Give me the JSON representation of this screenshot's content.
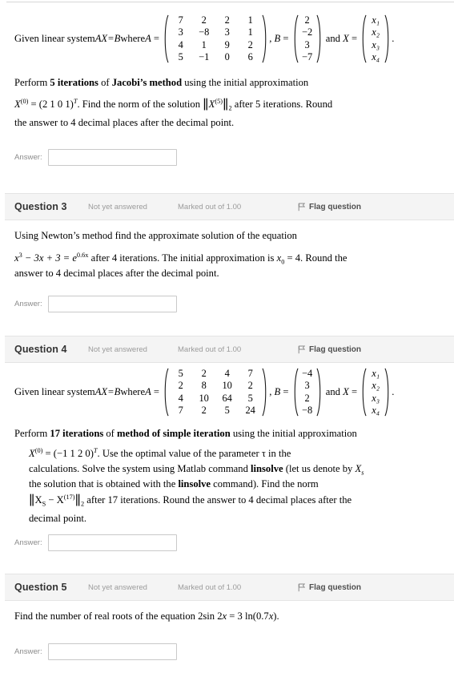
{
  "page": {
    "answer_label": "Answer:",
    "answer_placeholder": "",
    "answer_value": "",
    "flag_label": "Flag question",
    "state_label": "Not yet answered",
    "mark_label": "Marked out of 1.00"
  },
  "q2": {
    "intro": "Given linear system ",
    "system_name": "AX=B",
    "where": " where ",
    "A_label": "A",
    "A": [
      [
        "7",
        "2",
        "2",
        "1"
      ],
      [
        "3",
        "−8",
        "3",
        "1"
      ],
      [
        "4",
        "1",
        "9",
        "2"
      ],
      [
        "5",
        "−1",
        "0",
        "6"
      ]
    ],
    "B_label": "B",
    "B": [
      "2",
      "−2",
      "3",
      "−7"
    ],
    "and": "and",
    "X_label": "X",
    "X": [
      "x₁",
      "x₂",
      "x₃",
      "x₄"
    ],
    "line2_a": "Perform ",
    "line2_b": "5 iterations",
    "line2_c": " of ",
    "line2_d": "Jacobi’s method",
    "line2_e": " using the initial approximation",
    "line3_x0": "X",
    "line3_sup": "(0)",
    "line3_eq": " = (2   1   0   1)",
    "line3_T": "T",
    "line3_mid": ". Find the norm of the solution ",
    "line3_norm": "X",
    "line3_norm_sup": "(5)",
    "line3_norm_sub": "2",
    "line3_tail": " after 5 iterations. Round",
    "line4": "the answer to 4 decimal places after the decimal point."
  },
  "q3": {
    "number": "Question 3",
    "line1": "Using Newton’s method find the approximate solution of the equation",
    "eq_x": "x",
    "eq_x_sup": "3",
    "eq_mid": " − 3x + 3 = ",
    "eq_e": "e",
    "eq_e_sup": "0.6x",
    "eq_tail": " after 4 iterations. The initial approximation is ",
    "eq_x0": "x",
    "eq_x0_sub": "0",
    "eq_val": " = 4. Round the",
    "line3": "answer to 4 decimal places after the decimal point."
  },
  "q4": {
    "number": "Question 4",
    "intro": "Given linear system ",
    "system_name": "AX=B",
    "where": " where ",
    "A_label": "A",
    "A": [
      [
        "5",
        "2",
        "4",
        "7"
      ],
      [
        "2",
        "8",
        "10",
        "2"
      ],
      [
        "4",
        "10",
        "64",
        "5"
      ],
      [
        "7",
        "2",
        "5",
        "24"
      ]
    ],
    "B_label": "B",
    "B": [
      "−4",
      "3",
      "2",
      "−8"
    ],
    "and": "and",
    "X_label": "X",
    "X": [
      "x₁",
      "x₂",
      "x₃",
      "x₄"
    ],
    "line2_a": "Perform ",
    "line2_b": "17 iterations",
    "line2_c": " of ",
    "line2_d": "method of simple iteration",
    "line2_e": " using the initial approximation",
    "line3_x0": "X",
    "line3_sup": "(0)",
    "line3_eq": " = (−1   1   2   0)",
    "line3_T": "T",
    "line3_tail": ". Use the optimal value of the parameter τ in the",
    "line4_a": "calculations. Solve the system using Matlab command ",
    "line4_b": "linsolve",
    "line4_c": " (let us denote by ",
    "line4_d": "X",
    "line4_d_sub": "s",
    "line5_a": "the solution that is obtained with the ",
    "line5_b": "linsolve",
    "line5_c": " command). Find the norm",
    "line6_Xs": "X",
    "line6_Xs_sub": "S",
    "line6_minus": " − ",
    "line6_X": "X",
    "line6_X_sup": "(17)",
    "line6_sub2": "2",
    "line6_tail": " after 17 iterations.  Round the answer to 4 decimal places after the",
    "line7": "decimal point."
  },
  "q5": {
    "number": "Question 5",
    "line1_a": "Find the number of real roots of the equation 2sin 2",
    "line1_x": "x",
    "line1_b": " = 3 ln(0.7",
    "line1_x2": "x",
    "line1_c": ")."
  },
  "icons": {
    "flag": "flag-icon"
  },
  "colors": {
    "header_bg": "#f4f4f4",
    "header_border": "#e4e4e4",
    "muted_text": "#9b9b9b",
    "body_text": "#000000",
    "input_border": "#c9c9c9"
  }
}
